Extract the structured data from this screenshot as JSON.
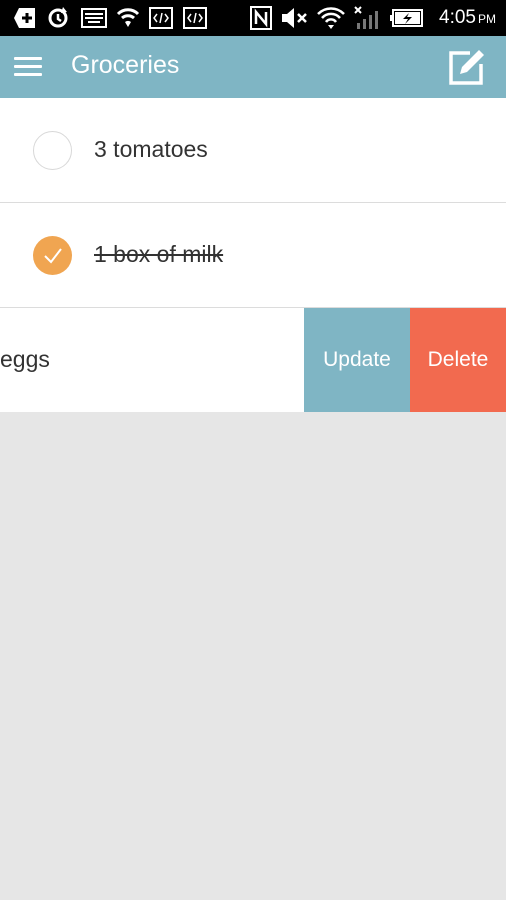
{
  "status_bar": {
    "time": "4:05",
    "ampm": "PM",
    "icons": [
      "add-box-icon",
      "sync-icon",
      "keyboard-icon",
      "shield-wifi-icon",
      "code-icon",
      "code-icon",
      "nfc-icon",
      "mute-icon",
      "wifi-icon",
      "no-signal-icon",
      "battery-charging-icon"
    ]
  },
  "app_bar": {
    "title": "Groceries",
    "menu_icon": "hamburger-menu-icon",
    "edit_icon": "edit-icon",
    "color": "#7fb5c4"
  },
  "items": [
    {
      "text": "3 tomatoes",
      "done": false
    },
    {
      "text": "1 box of milk",
      "done": true
    },
    {
      "text": "eggs",
      "done": false
    }
  ],
  "swipe_actions": {
    "update_label": "Update",
    "delete_label": "Delete",
    "update_color": "#7fb5c4",
    "delete_color": "#f26a4f"
  },
  "colors": {
    "check_done": "#f0a551",
    "background": "#e6e6e6"
  }
}
